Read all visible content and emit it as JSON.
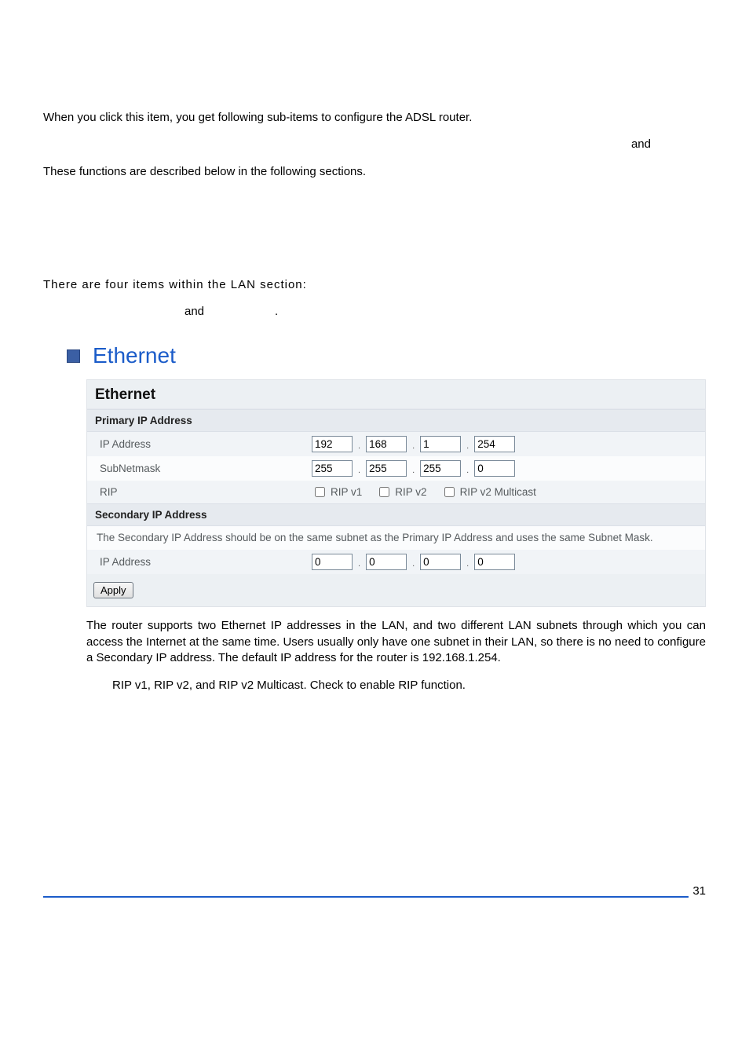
{
  "intro": {
    "p1": "When you click this item, you get following sub-items to configure the ADSL router.",
    "and1": "and",
    "p2": "These functions are described below in the following sections.",
    "lan1": "There  are  four  items  within  the  LAN  section:",
    "lan2_and": "and",
    "lan2_dot": "."
  },
  "section": {
    "title": "Ethernet"
  },
  "panel": {
    "title": "Ethernet",
    "primary_header": "Primary IP Address",
    "labels": {
      "ip": "IP Address",
      "subnet": "SubNetmask",
      "rip": "RIP",
      "sec_ip": "IP Address"
    },
    "primary_ip": [
      "192",
      "168",
      "1",
      "254"
    ],
    "subnet": [
      "255",
      "255",
      "255",
      "0"
    ],
    "rip": {
      "v1": "RIP v1",
      "v2": "RIP v2",
      "v2m": "RIP v2 Multicast"
    },
    "secondary_header": "Secondary IP Address",
    "secondary_note": "The Secondary IP Address should be on the same subnet as the Primary IP Address and uses the same Subnet Mask.",
    "secondary_ip": [
      "0",
      "0",
      "0",
      "0"
    ],
    "apply": "Apply"
  },
  "body": {
    "p": "The router supports two Ethernet IP addresses in the LAN, and two different LAN subnets through which you can access the Internet at the same time. Users usually only have one subnet in their LAN, so there is no need to configure a Secondary IP address. The default IP address for the router is 192.168.1.254.",
    "rip": "RIP v1, RIP v2, and RIP v2 Multicast. Check to enable RIP function."
  },
  "page_number": "31"
}
